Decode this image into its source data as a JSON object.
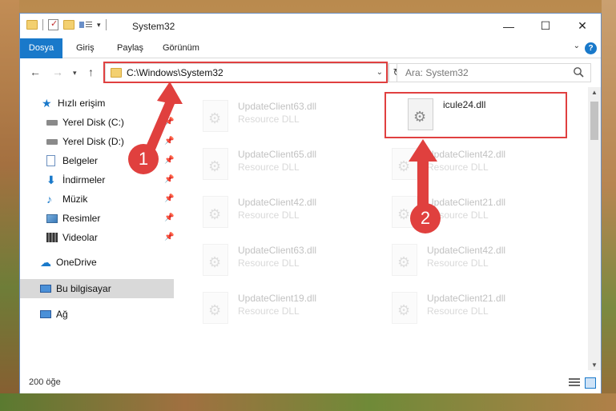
{
  "window": {
    "title": "System32",
    "controls": {
      "minimize": "—",
      "maximize": "☐",
      "close": "✕"
    }
  },
  "ribbon": {
    "tabs": [
      "Dosya",
      "Giriş",
      "Paylaş",
      "Görünüm"
    ],
    "help": "?"
  },
  "navigation": {
    "address": "C:\\Windows\\System32",
    "search_placeholder": "Ara: System32"
  },
  "sidebar": {
    "quick_access": "Hızlı erişim",
    "items": [
      {
        "label": "Yerel Disk (C:)",
        "icon": "drive-icon",
        "pinned": true
      },
      {
        "label": "Yerel Disk (D:)",
        "icon": "drive-icon",
        "pinned": true
      },
      {
        "label": "Belgeler",
        "icon": "documents-icon",
        "pinned": true
      },
      {
        "label": "İndirmeler",
        "icon": "download-icon",
        "pinned": true
      },
      {
        "label": "Müzik",
        "icon": "music-icon",
        "pinned": true
      },
      {
        "label": "Resimler",
        "icon": "pictures-icon",
        "pinned": true
      },
      {
        "label": "Videolar",
        "icon": "videos-icon",
        "pinned": true
      }
    ],
    "onedrive": "OneDrive",
    "this_pc": "Bu bilgisayar",
    "network": "Ağ"
  },
  "files": {
    "highlighted": {
      "name": "icule24.dll",
      "type": ""
    },
    "ghost_items": [
      {
        "name": "UpdateClient63.dll",
        "type": "Resource DLL"
      },
      {
        "name": "UpdateClient65.dll",
        "type": "Resource DLL"
      },
      {
        "name": "UpdateClient42.dll",
        "type": "Resource DLL"
      },
      {
        "name": "UpdateClient42.dll",
        "type": "Resource DLL"
      },
      {
        "name": "UpdateClient21.dll",
        "type": "Resource DLL"
      },
      {
        "name": "UpdateClient63.dll",
        "type": "Resource DLL"
      },
      {
        "name": "UpdateClient42.dll",
        "type": "Resource DLL"
      },
      {
        "name": "UpdateClient19.dll",
        "type": "Resource DLL"
      },
      {
        "name": "UpdateClient21.dll",
        "type": "Resource DLL"
      }
    ]
  },
  "status": {
    "count": "200 öğe"
  },
  "annotations": {
    "step1": "1",
    "step2": "2"
  },
  "colors": {
    "accent": "#1979ca",
    "highlight": "#e04040"
  }
}
